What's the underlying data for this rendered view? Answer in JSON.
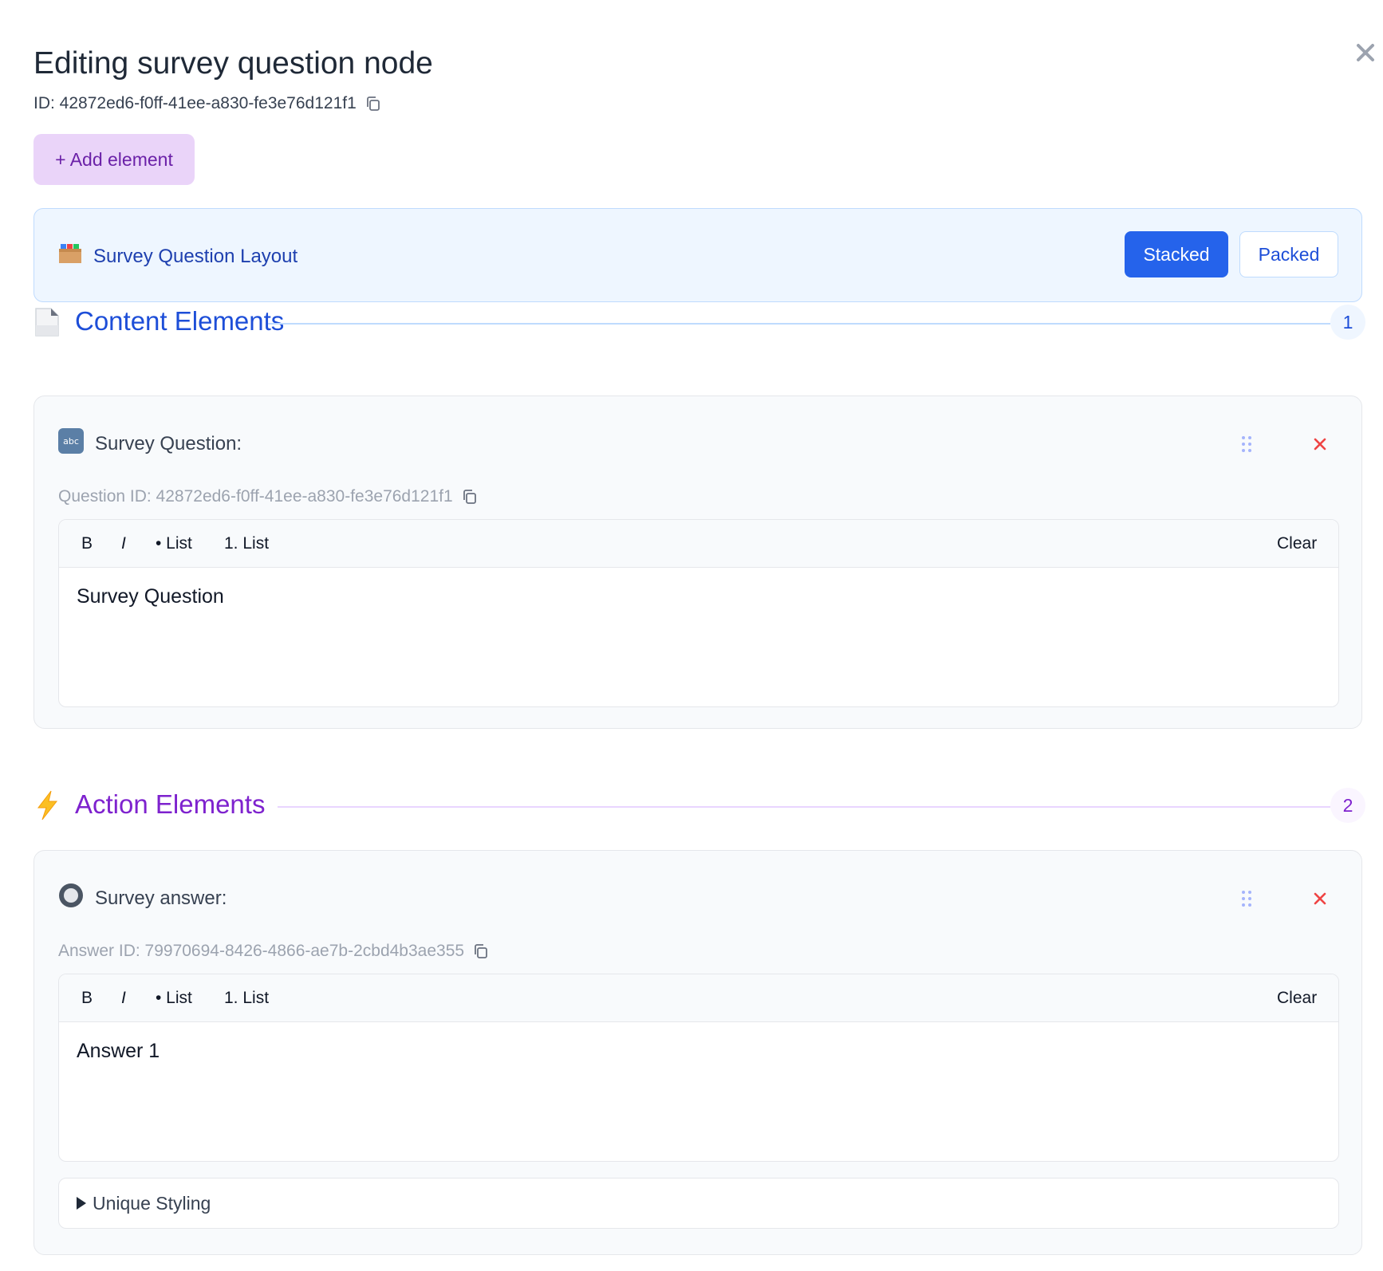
{
  "header": {
    "title": "Editing survey question node",
    "id_text": "ID: 42872ed6-f0ff-41ee-a830-fe3e76d121f1",
    "add_element_label": "+ Add element"
  },
  "layout": {
    "label": "Survey Question Layout",
    "icon": "folder-icon",
    "options": [
      {
        "label": "Stacked",
        "selected": true
      },
      {
        "label": "Packed",
        "selected": false
      }
    ]
  },
  "content_section": {
    "title": "Content Elements",
    "count": "1",
    "icon": "document-icon",
    "color": "#1d4ed8",
    "elements": [
      {
        "label": "Survey Question:",
        "icon": "abc-icon",
        "id_text": "Question ID: 42872ed6-f0ff-41ee-a830-fe3e76d121f1",
        "toolbar": {
          "bold": "B",
          "italic": "I",
          "bullet_list": "• List",
          "numbered_list": "1. List",
          "clear": "Clear"
        },
        "content": "Survey Question"
      }
    ]
  },
  "action_section": {
    "title": "Action Elements",
    "count": "2",
    "icon": "lightning-icon",
    "color": "#7e22ce",
    "elements": [
      {
        "label": "Survey answer:",
        "icon": "radio-button-icon",
        "id_text": "Answer ID: 79970694-8426-4866-ae7b-2cbd4b3ae355",
        "toolbar": {
          "bold": "B",
          "italic": "I",
          "bullet_list": "• List",
          "numbered_list": "1. List",
          "clear": "Clear"
        },
        "content": "Answer 1",
        "disclosure_label": "Unique Styling"
      }
    ]
  },
  "colors": {
    "primary": "#2563eb",
    "delete": "#ef4444",
    "add_button_bg": "#ead4f9",
    "add_button_text": "#6b21a8"
  }
}
